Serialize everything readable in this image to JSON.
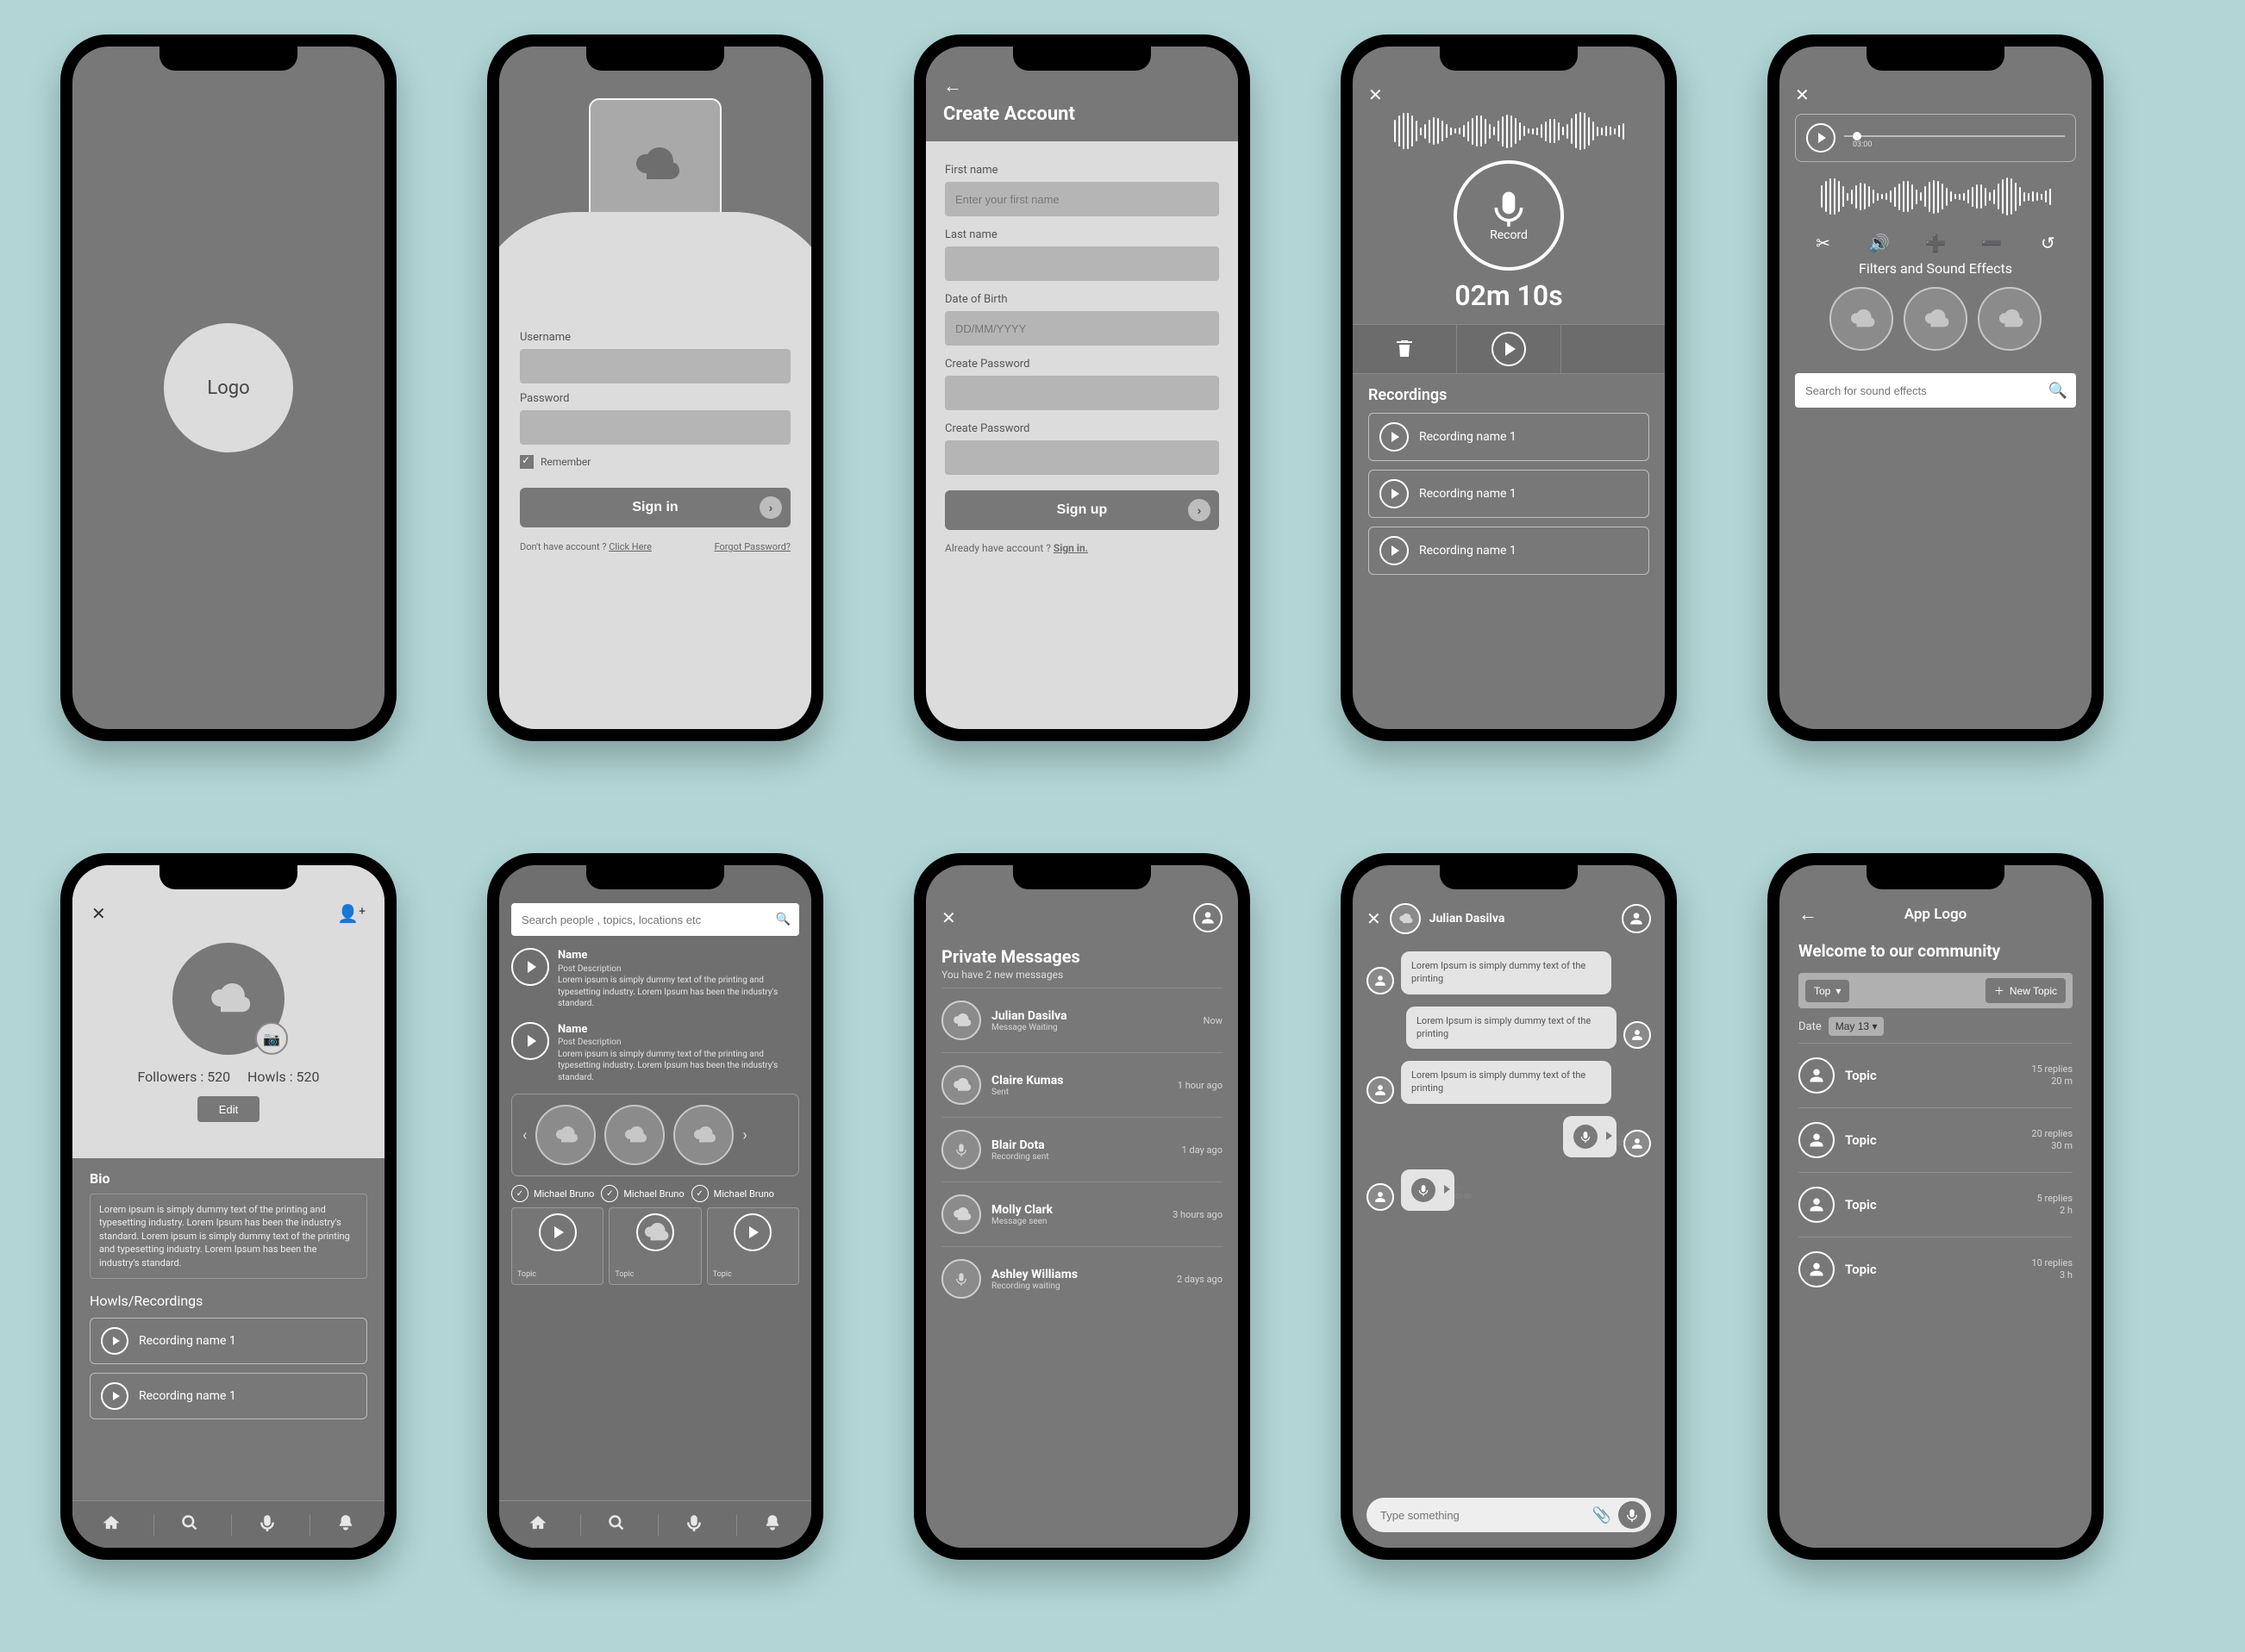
{
  "splash": {
    "logo_text": "Logo"
  },
  "signin": {
    "username_label": "Username",
    "password_label": "Password",
    "remember_label": "Remember",
    "button_label": "Sign in",
    "no_account_text": "Don't have account ? ",
    "click_here": "Click Here",
    "forgot_link": "Forgot Password?"
  },
  "signup": {
    "title": "Create Account",
    "first_label": "First name",
    "first_ph": "Enter your first name",
    "last_label": "Last name",
    "dob_label": "Date of Birth",
    "dob_ph": "DD/MM/YYYY",
    "pw1_label": "Create Password",
    "pw2_label": "Create Password",
    "button_label": "Sign up",
    "already_text": "Already have account ? ",
    "signin_link": "Sign in."
  },
  "recorder": {
    "mic_label": "Record",
    "timer": "02m 10s",
    "section_title": "Recordings",
    "items": [
      {
        "name": "Recording name 1"
      },
      {
        "name": "Recording name 1"
      },
      {
        "name": "Recording name 1"
      }
    ]
  },
  "editor": {
    "player_time": "03:00",
    "filters_title": "Filters and Sound Effects",
    "search_ph": "Search for sound effects"
  },
  "profile": {
    "followers_label": "Followers : 520",
    "howls_label": "Howls : 520",
    "edit": "Edit",
    "bio_title": "Bio",
    "bio_text": "Lorem ipsum is simply dummy text of the printing and typesetting industry. Lorem Ipsum has been the industry's standard.\nLorem ipsum is simply dummy text of the printing and typesetting industry. Lorem Ipsum has been the industry's standard.",
    "recordings_title": "Howls/Recordings",
    "recordings": [
      {
        "name": "Recording name 1"
      },
      {
        "name": "Recording name 1"
      }
    ]
  },
  "feed": {
    "search_ph": "Search people , topics, locations etc",
    "posts": [
      {
        "name": "Name",
        "sub": "Post Description",
        "body": "Lorem ipsum is simply dummy text of the printing and typesetting industry. Lorem Ipsum has been the industry's standard."
      },
      {
        "name": "Name",
        "sub": "Post Description",
        "body": "Lorem ipsum is simply dummy text of the printing and typesetting industry. Lorem Ipsum has been the industry's standard."
      }
    ],
    "suggestions": [
      "Michael Bruno",
      "Michael Bruno",
      "Michael Bruno"
    ],
    "topic_label": "Topic"
  },
  "messages": {
    "title": "Private Messages",
    "subtitle": "You have 2 new messages",
    "items": [
      {
        "name": "Julian Dasilva",
        "status": "Message Waiting",
        "when": "Now",
        "icon": "cloud"
      },
      {
        "name": "Claire Kumas",
        "status": "Sent",
        "when": "1 hour ago",
        "icon": "cloud"
      },
      {
        "name": "Blair Dota",
        "status": "Recording sent",
        "when": "1 day ago",
        "icon": "mic"
      },
      {
        "name": "Molly Clark",
        "status": "Message seen",
        "when": "3 hours ago",
        "icon": "cloud"
      },
      {
        "name": "Ashley Williams",
        "status": "Recording waiting",
        "when": "2 days ago",
        "icon": "mic"
      }
    ]
  },
  "chat": {
    "with_name": "Julian Dasilva",
    "input_ph": "Type something",
    "bubbles": [
      {
        "side": "left",
        "type": "text",
        "text": "Lorem Ipsum is simply dummy text of the printing"
      },
      {
        "side": "right",
        "type": "text",
        "text": "Lorem Ipsum is simply dummy text of the printing"
      },
      {
        "side": "left",
        "type": "text",
        "text": "Lorem Ipsum is simply dummy text of the printing"
      },
      {
        "side": "right",
        "type": "audio",
        "time": "03:00"
      },
      {
        "side": "left",
        "type": "audio",
        "time": "03:00"
      }
    ]
  },
  "community": {
    "app_logo": "App Logo",
    "welcome": "Welcome to our community",
    "sort_label": "Top",
    "new_topic": "New Topic",
    "date_label": "Date",
    "date_value": "May 13",
    "topics": [
      {
        "title": "Topic",
        "replies": "15 replies",
        "age": "20 m"
      },
      {
        "title": "Topic",
        "replies": "20 replies",
        "age": "30 m"
      },
      {
        "title": "Topic",
        "replies": "5 replies",
        "age": "2 h"
      },
      {
        "title": "Topic",
        "replies": "10 replies",
        "age": "3 h"
      }
    ]
  }
}
